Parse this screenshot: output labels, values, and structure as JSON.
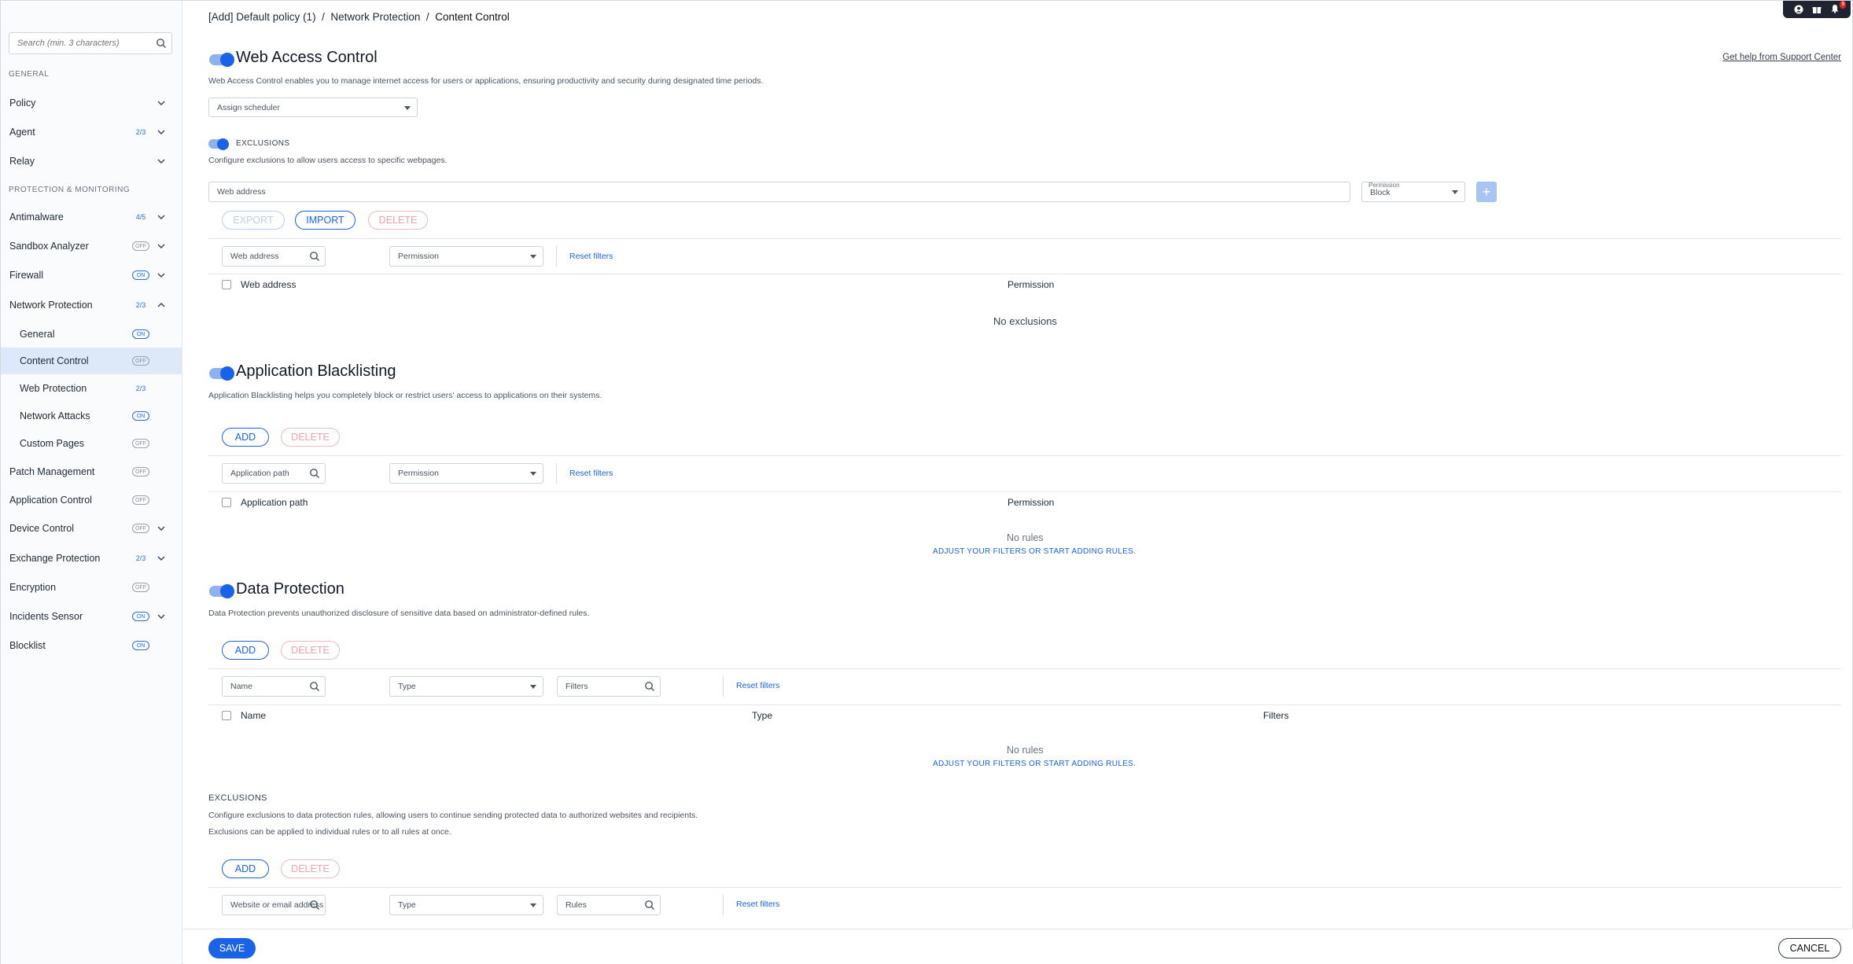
{
  "sidebar": {
    "search_placeholder": "Search (min. 3 characters)",
    "section_general": "GENERAL",
    "section_protection": "PROTECTION & MONITORING",
    "items": [
      {
        "label": "Policy",
        "badge": "",
        "badge_type": "",
        "chevron": "down"
      },
      {
        "label": "Agent",
        "badge": "2/3",
        "badge_type": "users",
        "chevron": "down"
      },
      {
        "label": "Relay",
        "badge": "",
        "badge_type": "",
        "chevron": "down"
      },
      {
        "label": "Antimalware",
        "badge": "4/5",
        "badge_type": "users",
        "chevron": "down"
      },
      {
        "label": "Sandbox Analyzer",
        "badge": "OFF",
        "badge_type": "off",
        "chevron": "down"
      },
      {
        "label": "Firewall",
        "badge": "ON",
        "badge_type": "on",
        "chevron": "down"
      },
      {
        "label": "Network Protection",
        "badge": "2/3",
        "badge_type": "users",
        "chevron": "up"
      },
      {
        "label": "General",
        "badge": "ON",
        "badge_type": "on",
        "chevron": ""
      },
      {
        "label": "Content Control",
        "badge": "OFF",
        "badge_type": "off",
        "chevron": ""
      },
      {
        "label": "Web Protection",
        "badge": "2/3",
        "badge_type": "users",
        "chevron": ""
      },
      {
        "label": "Network Attacks",
        "badge": "ON",
        "badge_type": "on",
        "chevron": ""
      },
      {
        "label": "Custom Pages",
        "badge": "OFF",
        "badge_type": "off",
        "chevron": ""
      },
      {
        "label": "Patch Management",
        "badge": "OFF",
        "badge_type": "off",
        "chevron": ""
      },
      {
        "label": "Application Control",
        "badge": "OFF",
        "badge_type": "off",
        "chevron": ""
      },
      {
        "label": "Device Control",
        "badge": "OFF",
        "badge_type": "off",
        "chevron": "down"
      },
      {
        "label": "Exchange Protection",
        "badge": "2/3",
        "badge_type": "users",
        "chevron": "down"
      },
      {
        "label": "Encryption",
        "badge": "OFF",
        "badge_type": "off",
        "chevron": ""
      },
      {
        "label": "Incidents Sensor",
        "badge": "ON",
        "badge_type": "on",
        "chevron": "down"
      },
      {
        "label": "Blocklist",
        "badge": "ON",
        "badge_type": "on",
        "chevron": ""
      }
    ]
  },
  "breadcrumb": {
    "part1": "[Add] Default policy (1)",
    "sep": "/",
    "part2": "Network Protection",
    "part3": "Content Control"
  },
  "topbar": {
    "notif_count": "9"
  },
  "help_link": "Get help from Support Center",
  "web_access": {
    "title": "Web Access Control",
    "desc": "Web Access Control enables you to manage internet access for users or applications, ensuring productivity and security during designated time periods.",
    "scheduler": "Assign scheduler",
    "exclusions_label": "EXCLUSIONS",
    "exclusions_desc": "Configure exclusions to allow users access to specific webpages.",
    "web_address_placeholder": "Web address",
    "permission_float": "Permission",
    "permission_value": "Block",
    "plus": "+",
    "export": "EXPORT",
    "import": "IMPORT",
    "delete": "DELETE",
    "filter_web": "Web address",
    "filter_perm": "Permission",
    "reset": "Reset filters",
    "col_web": "Web address",
    "col_perm": "Permission",
    "empty": "No exclusions"
  },
  "app_black": {
    "title": "Application Blacklisting",
    "desc": "Application Blacklisting helps you completely block or restrict users' access to applications on their systems.",
    "add": "ADD",
    "delete": "DELETE",
    "filter_path": "Application path",
    "filter_perm": "Permission",
    "reset": "Reset filters",
    "col_path": "Application path",
    "col_perm": "Permission",
    "empty": "No rules",
    "adjust": "ADJUST YOUR FILTERS OR START ADDING RULES."
  },
  "data_prot": {
    "title": "Data Protection",
    "desc": "Data Protection prevents unauthorized disclosure of sensitive data based on administrator-defined rules.",
    "add": "ADD",
    "delete": "DELETE",
    "filter_name": "Name",
    "filter_type": "Type",
    "filter_filters": "Filters",
    "reset": "Reset filters",
    "col_name": "Name",
    "col_type": "Type",
    "col_filters": "Filters",
    "empty": "No rules",
    "adjust": "ADJUST YOUR FILTERS OR START ADDING RULES.",
    "excl_label": "EXCLUSIONS",
    "excl_desc1": "Configure exclusions to data protection rules, allowing users to continue sending protected data to authorized websites and recipients.",
    "excl_desc2": "Exclusions can be applied to individual rules or to all rules at once.",
    "excl_add": "ADD",
    "excl_delete": "DELETE",
    "excl_filter_web": "Website or email address",
    "excl_filter_type": "Type",
    "excl_filter_rules": "Rules",
    "excl_reset": "Reset filters"
  },
  "footer": {
    "save": "SAVE",
    "cancel": "CANCEL"
  }
}
